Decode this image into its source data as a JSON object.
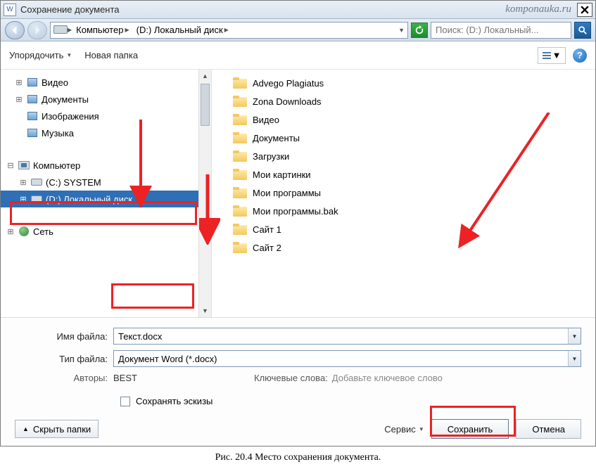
{
  "window": {
    "title": "Сохранение документа",
    "watermark": "komponauka.ru"
  },
  "addressbar": {
    "segments": [
      "Компьютер",
      "(D:) Локальный диск"
    ]
  },
  "search": {
    "placeholder": "Поиск: (D:) Локальный..."
  },
  "toolbar": {
    "organize": "Упорядочить",
    "new_folder": "Новая папка",
    "help_symbol": "?"
  },
  "tree": {
    "libs": [
      {
        "label": "Видео"
      },
      {
        "label": "Документы"
      },
      {
        "label": "Изображения"
      },
      {
        "label": "Музыка"
      }
    ],
    "computer_label": "Компьютер",
    "drives": [
      {
        "label": "(C:) SYSTEM",
        "selected": false
      },
      {
        "label": "(D:) Локальный диск",
        "selected": true
      }
    ],
    "network_label": "Сеть"
  },
  "files": [
    "Advego Plagiatus",
    "Zona Downloads",
    "Видео",
    "Документы",
    "Загрузки",
    "Мои картинки",
    "Мои программы",
    "Мои программы.bak",
    "Сайт 1",
    "Сайт 2"
  ],
  "form": {
    "filename_label": "Имя файла:",
    "filename_value": "Текст.docx",
    "filetype_label": "Тип файла:",
    "filetype_value": "Документ Word (*.docx)",
    "authors_label": "Авторы:",
    "authors_value": "BEST",
    "keywords_label": "Ключевые слова:",
    "keywords_hint": "Добавьте ключевое слово",
    "save_thumbnails": "Сохранять эскизы"
  },
  "buttons": {
    "hide_folders": "Скрыть папки",
    "tools": "Сервис",
    "save": "Сохранить",
    "cancel": "Отмена"
  },
  "caption": "Рис. 20.4  Место сохранения документа."
}
